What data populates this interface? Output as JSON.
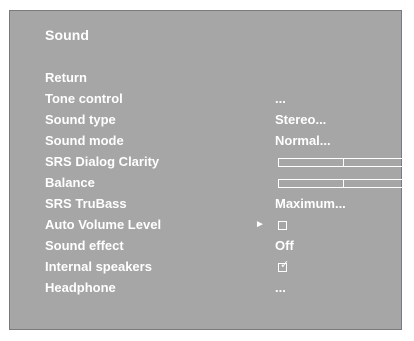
{
  "menu": {
    "title": "Sound",
    "items": [
      {
        "label": "Return",
        "value": ""
      },
      {
        "label": "Tone control",
        "value": "..."
      },
      {
        "label": "Sound type",
        "value": "Stereo..."
      },
      {
        "label": "Sound mode",
        "value": "Normal..."
      },
      {
        "label": "SRS Dialog Clarity",
        "value": ""
      },
      {
        "label": "Balance",
        "value": ""
      },
      {
        "label": "SRS TruBass",
        "value": "Maximum..."
      },
      {
        "label": "Auto Volume Level",
        "value": ""
      },
      {
        "label": "Sound effect",
        "value": "Off"
      },
      {
        "label": "Internal speakers",
        "value": ""
      },
      {
        "label": "Headphone",
        "value": "..."
      }
    ],
    "selected_arrow": "►",
    "internal_speakers_checked": true,
    "auto_volume_checked": false,
    "srs_dialog_clarity_level": 0.5,
    "balance_level": 0.5,
    "colors": {
      "panel": "#a6a6a6",
      "text": "#ffffff"
    }
  }
}
